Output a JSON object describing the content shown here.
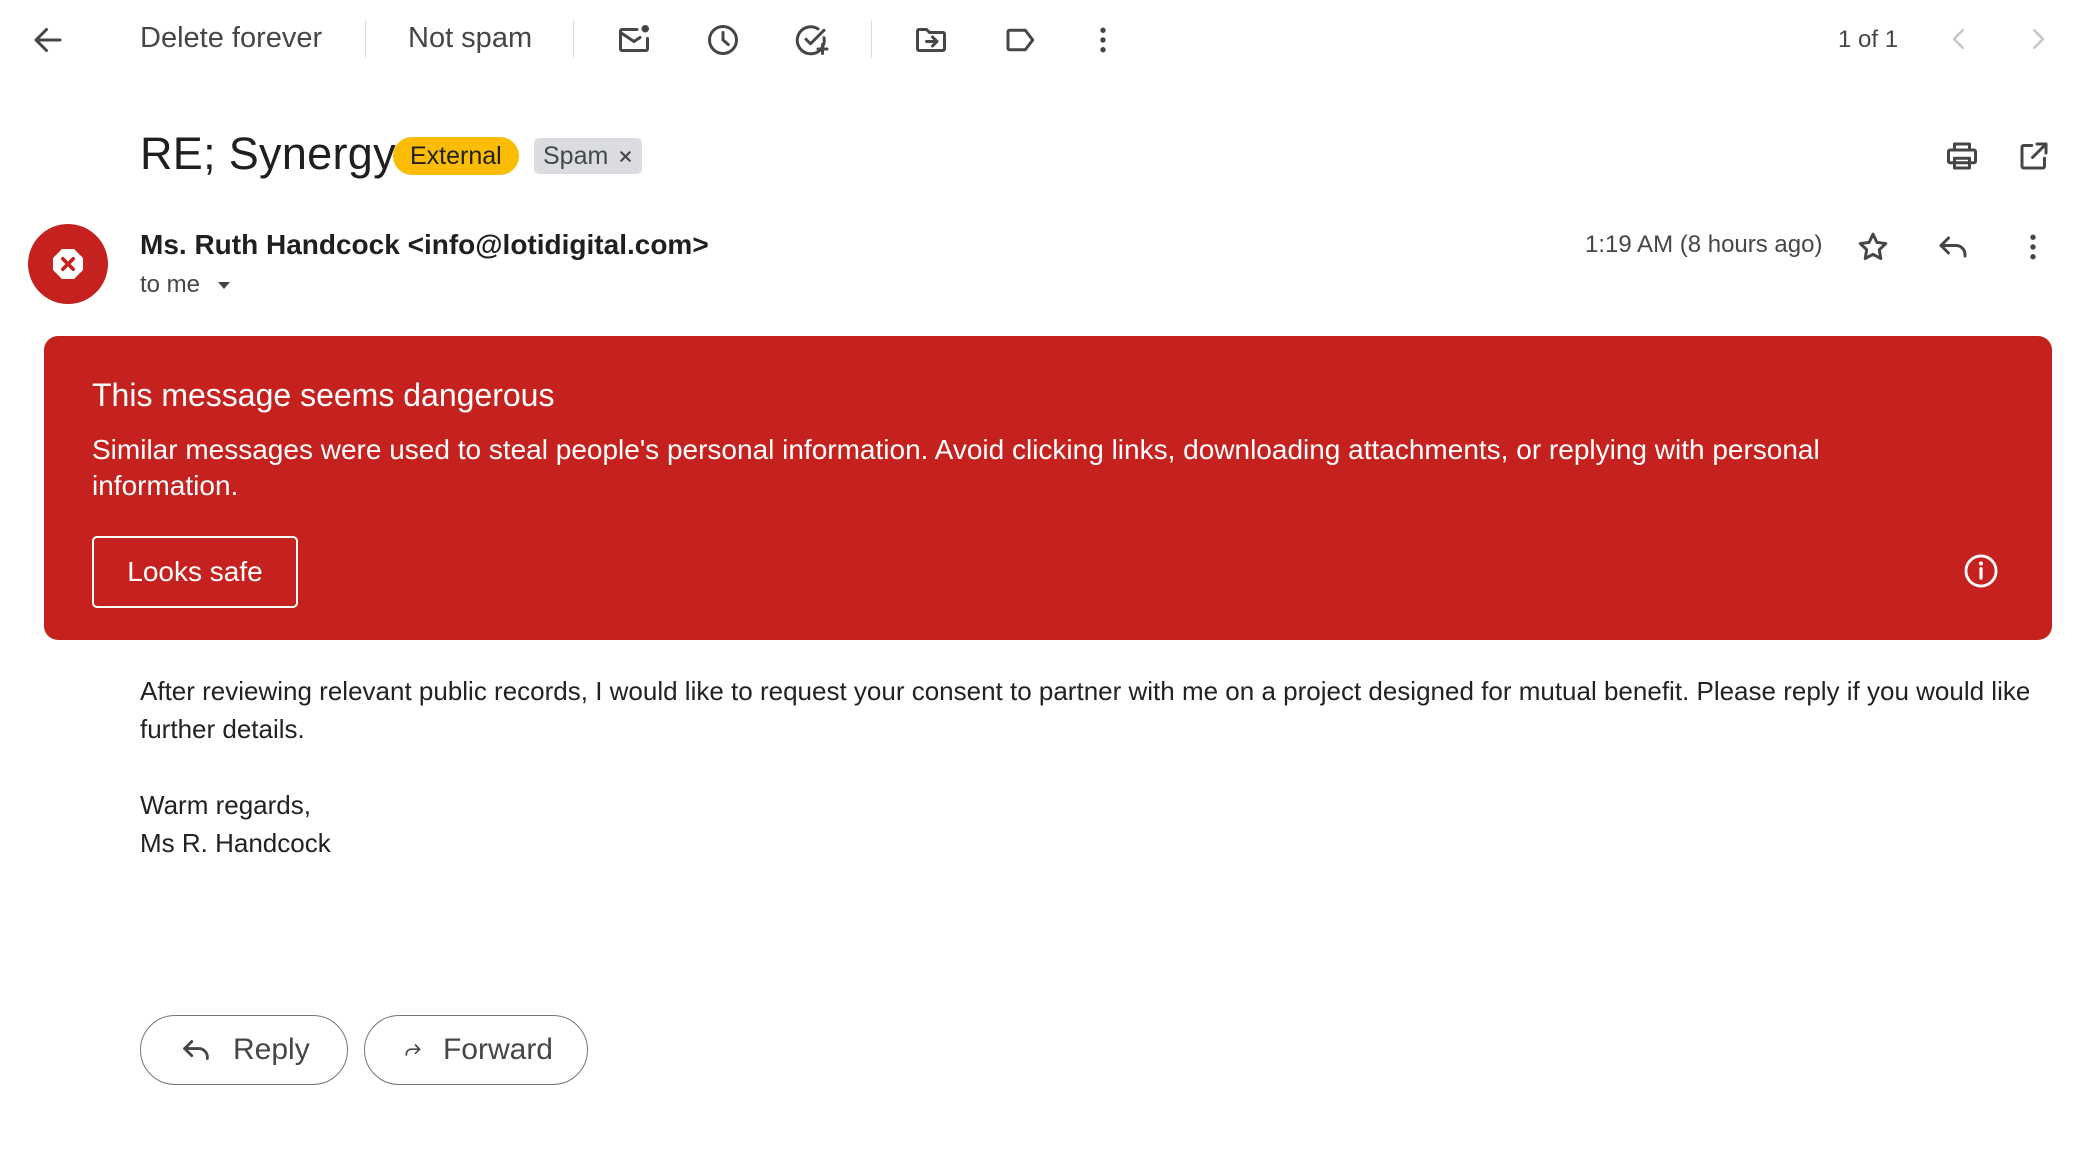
{
  "toolbar": {
    "delete_forever": "Delete forever",
    "not_spam": "Not spam",
    "pagination": "1 of 1"
  },
  "message": {
    "subject": "RE; Synergy",
    "labels": {
      "external": "External",
      "spam": "Spam"
    },
    "sender": "Ms. Ruth Handcock <info@lotidigital.com>",
    "recipient": "to me",
    "time": "1:19 AM (8 hours ago)",
    "body": {
      "paragraph": "After reviewing relevant public records, I would like to request your consent to partner with me on a project designed for mutual benefit. Please reply if you would like further details.",
      "closing": "Warm regards,",
      "signature": "Ms R. Handcock"
    }
  },
  "warning": {
    "title": "This message seems dangerous",
    "text": "Similar messages were used to steal people's personal information. Avoid clicking links, downloading attachments, or replying with personal information.",
    "button": "Looks safe"
  },
  "actions": {
    "reply": "Reply",
    "forward": "Forward"
  },
  "colors": {
    "danger_red": "#c5221f",
    "external_label": "#fbbc04",
    "spam_label": "#dadce0"
  }
}
